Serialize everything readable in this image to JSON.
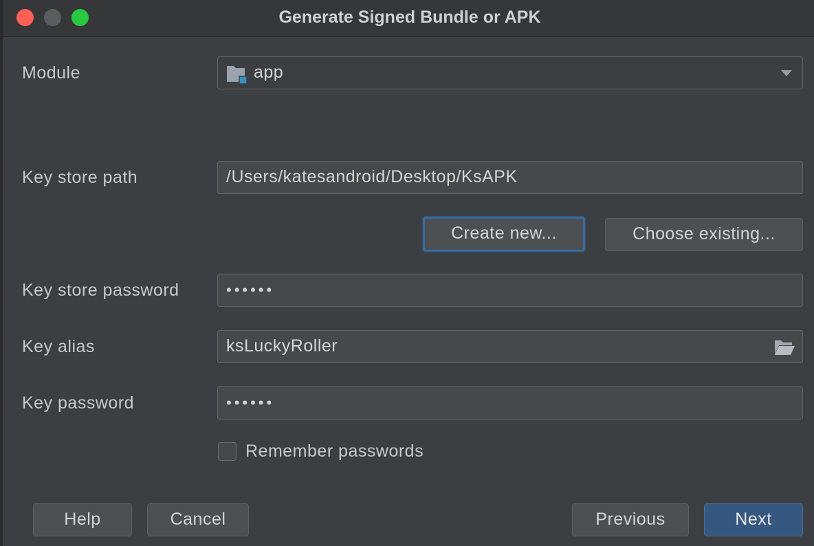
{
  "window": {
    "title": "Generate Signed Bundle or APK"
  },
  "module": {
    "label": "Module",
    "value": "app"
  },
  "key_store_path": {
    "label": "Key store path",
    "value": "/Users/katesandroid/Desktop/KsAPK"
  },
  "key_store_buttons": {
    "create_new": "Create new...",
    "choose_existing": "Choose existing..."
  },
  "key_store_password": {
    "label": "Key store password",
    "value": "••••••"
  },
  "key_alias": {
    "label": "Key alias",
    "value": "ksLuckyRoller"
  },
  "key_password": {
    "label": "Key password",
    "value": "••••••"
  },
  "remember": {
    "label": "Remember passwords",
    "checked": false
  },
  "footer": {
    "help": "Help",
    "cancel": "Cancel",
    "previous": "Previous",
    "next": "Next"
  },
  "icons": {
    "module": "module-folder-icon",
    "alias_picker": "folder-open-icon",
    "dropdown": "chevron-down-icon"
  },
  "colors": {
    "primary_button": "#365880",
    "focus_ring": "#3b6a9a",
    "close": "#fe5f57",
    "zoom": "#28c840"
  }
}
